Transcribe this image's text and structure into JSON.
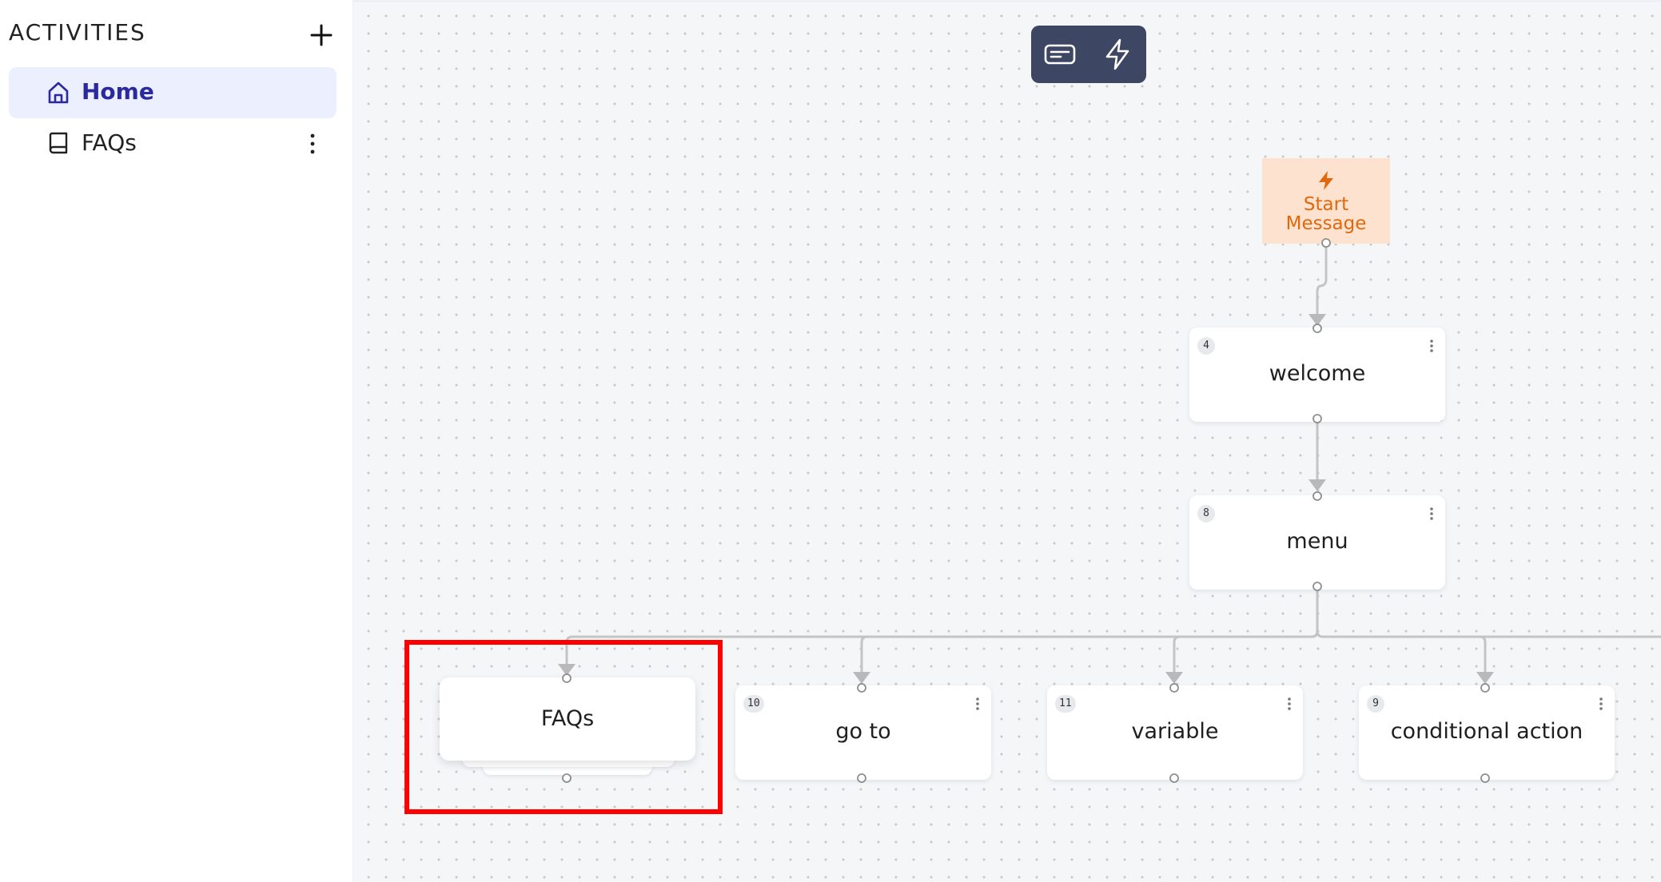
{
  "sidebar": {
    "title": "ACTIVITIES",
    "add_icon": "plus-icon",
    "items": [
      {
        "label": "Home",
        "icon": "home-icon",
        "active": true
      },
      {
        "label": "FAQs",
        "icon": "book-icon",
        "active": false
      }
    ]
  },
  "toolbar": {
    "buttons": [
      {
        "icon": "message-card-icon"
      },
      {
        "icon": "lightning-icon"
      }
    ],
    "color": "#3d4663"
  },
  "flow": {
    "start": {
      "label": "Start\nMessage",
      "icon": "lightning-icon",
      "color": "#e0680e",
      "background": "#fde3cf"
    },
    "nodes": [
      {
        "id": "4",
        "label": "welcome"
      },
      {
        "id": "8",
        "label": "menu"
      },
      {
        "id": "",
        "label": "FAQs"
      },
      {
        "id": "10",
        "label": "go to"
      },
      {
        "id": "11",
        "label": "variable"
      },
      {
        "id": "9",
        "label": "conditional action"
      }
    ]
  },
  "highlight_color": "#ff0000"
}
